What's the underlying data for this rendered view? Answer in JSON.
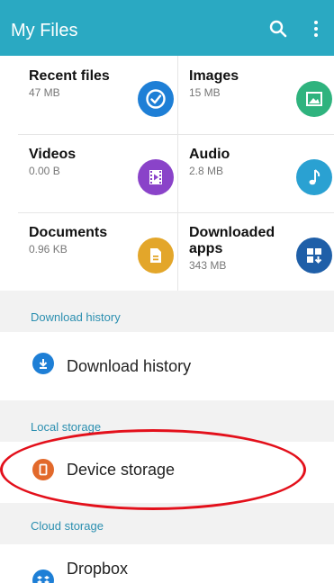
{
  "appbar": {
    "title": "My Files",
    "search_icon": "search-icon",
    "more_icon": "more-vert-icon"
  },
  "categories": [
    {
      "title": "Recent files",
      "sub": "47 MB",
      "icon": "clock-icon",
      "color": "#1e7fd6"
    },
    {
      "title": "Images",
      "sub": "15 MB",
      "icon": "image-icon",
      "color": "#2fb37e"
    },
    {
      "title": "Videos",
      "sub": "0.00 B",
      "icon": "film-icon",
      "color": "#8a43c9"
    },
    {
      "title": "Audio",
      "sub": "2.8 MB",
      "icon": "music-note-icon",
      "color": "#2aa1d2"
    },
    {
      "title": "Documents",
      "sub": "0.96 KB",
      "icon": "document-icon",
      "color": "#e3a62a"
    },
    {
      "title_line1": "Downloaded",
      "title_line2": "apps",
      "sub": "343 MB",
      "icon": "apps-download-icon",
      "color": "#1f5fa8"
    }
  ],
  "download_history": {
    "section": "Download history",
    "item": "Download history",
    "icon": "download-icon",
    "color": "#1e7fd6"
  },
  "local_storage": {
    "section": "Local storage",
    "item": "Device storage",
    "icon": "phone-icon",
    "color": "#e2692b"
  },
  "cloud_storage": {
    "section": "Cloud storage",
    "item": "Dropbox",
    "icon": "dropbox-icon",
    "color": "#1e7fd6"
  },
  "annotation": {
    "color": "#e3101b"
  }
}
